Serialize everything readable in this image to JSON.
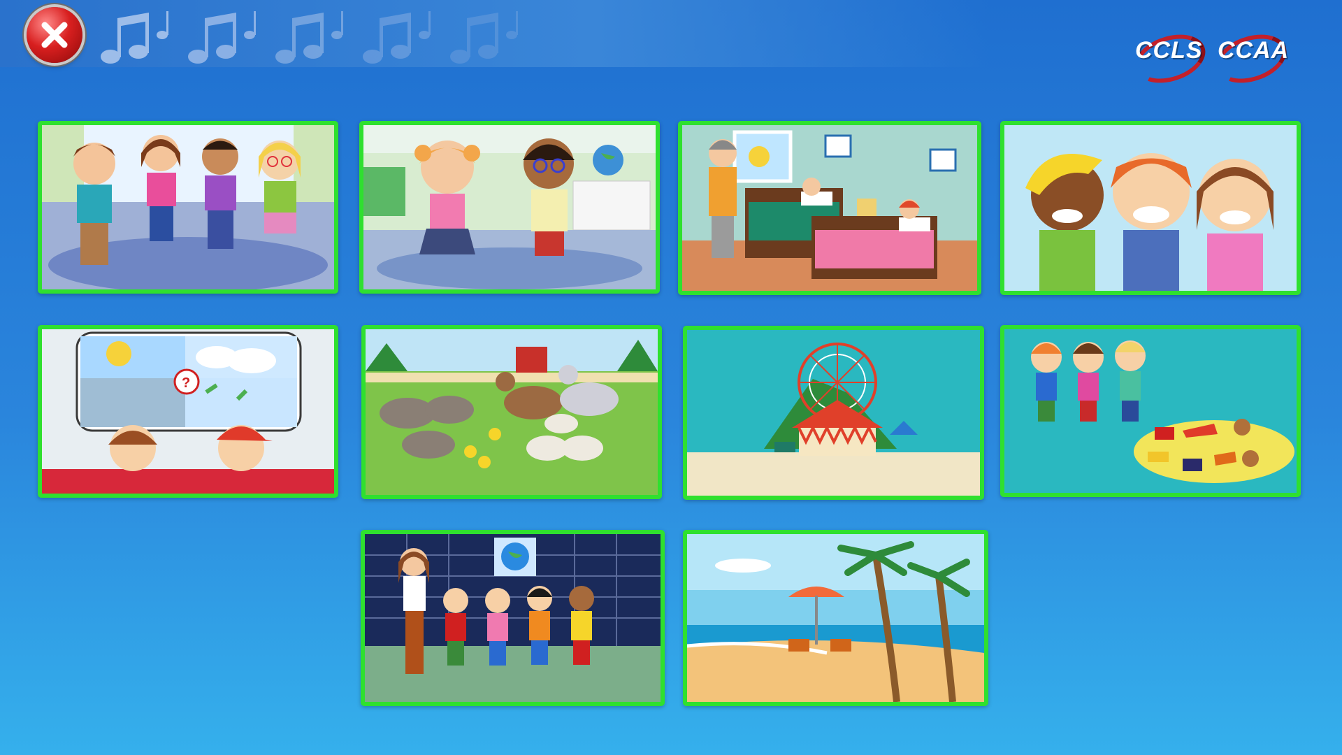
{
  "header": {
    "close_icon": "close-icon",
    "decor_icon": "music-note-icon",
    "logos": [
      "CCLS",
      "CCAA"
    ]
  },
  "tiles": [
    {
      "scene": "kids-dancing-classroom"
    },
    {
      "scene": "two-kids-waving-classroom"
    },
    {
      "scene": "bedroom-grandmother-kids-in-bed"
    },
    {
      "scene": "three-kids-pointing"
    },
    {
      "scene": "weather-question-kids"
    },
    {
      "scene": "farm-animals"
    },
    {
      "scene": "amusement-park"
    },
    {
      "scene": "kids-and-toys"
    },
    {
      "scene": "teacher-and-students-globe"
    },
    {
      "scene": "beach"
    }
  ],
  "colors": {
    "tile_border": "#2fe02f",
    "close_red": "#d81f1f",
    "logo_red": "#c3202a"
  }
}
